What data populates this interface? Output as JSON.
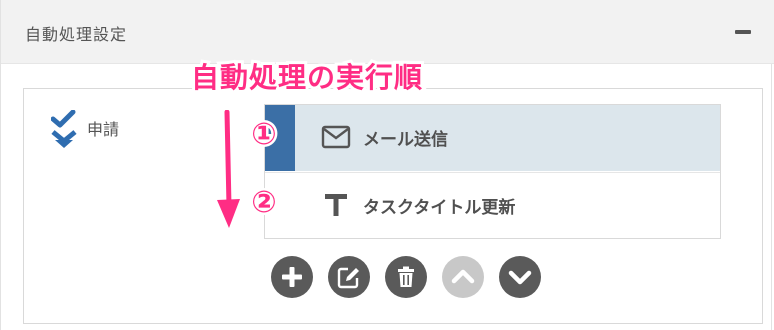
{
  "panel": {
    "title": "自動処理設定",
    "collapse_icon": "minus-icon"
  },
  "trigger": {
    "label": "申請",
    "icon": "double-check-down-icon"
  },
  "actions": [
    {
      "label": "メール送信",
      "icon": "envelope-icon",
      "selected": true
    },
    {
      "label": "タスクタイトル更新",
      "icon": "text-t-icon",
      "selected": false
    }
  ],
  "toolbar": {
    "buttons": [
      {
        "icon": "plus-icon",
        "enabled": true
      },
      {
        "icon": "edit-icon",
        "enabled": true
      },
      {
        "icon": "trash-icon",
        "enabled": true
      },
      {
        "icon": "chevron-up-icon",
        "enabled": false
      },
      {
        "icon": "chevron-down-icon",
        "enabled": true
      }
    ]
  },
  "annotation": {
    "title": "自動処理の実行順",
    "steps": [
      "①",
      "②"
    ],
    "color": "#ff2d84"
  },
  "colors": {
    "selected_bar": "#3b6fa6",
    "selected_row": "#dce6ec",
    "trigger_icon": "#2f6db0"
  }
}
